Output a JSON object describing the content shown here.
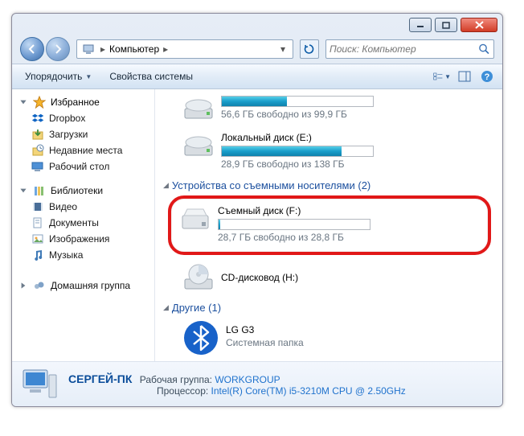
{
  "titlebar": {
    "buttons": [
      "minimize",
      "maximize",
      "close"
    ]
  },
  "address": {
    "crumb1": "Компьютер",
    "search_placeholder": "Поиск: Компьютер"
  },
  "toolbar": {
    "organize": "Упорядочить",
    "properties": "Свойства системы"
  },
  "sidebar": {
    "favorites": {
      "label": "Избранное",
      "items": [
        {
          "icon": "dropbox",
          "label": "Dropbox"
        },
        {
          "icon": "downloads",
          "label": "Загрузки"
        },
        {
          "icon": "recent",
          "label": "Недавние места"
        },
        {
          "icon": "desktop",
          "label": "Рабочий стол"
        }
      ]
    },
    "libraries": {
      "label": "Библиотеки",
      "items": [
        {
          "icon": "video",
          "label": "Видео"
        },
        {
          "icon": "docs",
          "label": "Документы"
        },
        {
          "icon": "images",
          "label": "Изображения"
        },
        {
          "icon": "music",
          "label": "Музыка"
        }
      ]
    },
    "homegroup": {
      "label": "Домашняя группа"
    }
  },
  "drives": {
    "d1": {
      "free": "56,6 ГБ свободно из 99,9 ГБ"
    },
    "e": {
      "name": "Локальный диск (E:)",
      "free": "28,9 ГБ свободно из 138 ГБ",
      "fill_pct": 79
    },
    "removable_header": "Устройства со съемными носителями (2)",
    "f": {
      "name": "Съемный диск (F:)",
      "free": "28,7 ГБ свободно из 28,8 ГБ",
      "fill_pct": 1
    },
    "h": {
      "name": "CD-дисковод (H:)"
    },
    "other_header": "Другие (1)",
    "lg": {
      "name": "LG G3",
      "sub": "Системная папка"
    }
  },
  "details": {
    "name": "СЕРГЕЙ-ПК",
    "wg_label": "Рабочая группа:",
    "wg_value": "WORKGROUP",
    "cpu_label": "Процессор:",
    "cpu_value": "Intel(R) Core(TM) i5-3210M CPU @ 2.50GHz"
  },
  "chart_data": {
    "type": "bar",
    "title": "Disk usage",
    "series": [
      {
        "name": "Локальный диск (E:)",
        "used_gb": 109.1,
        "total_gb": 138
      },
      {
        "name": "Съемный диск (F:)",
        "used_gb": 0.1,
        "total_gb": 28.8
      }
    ]
  }
}
